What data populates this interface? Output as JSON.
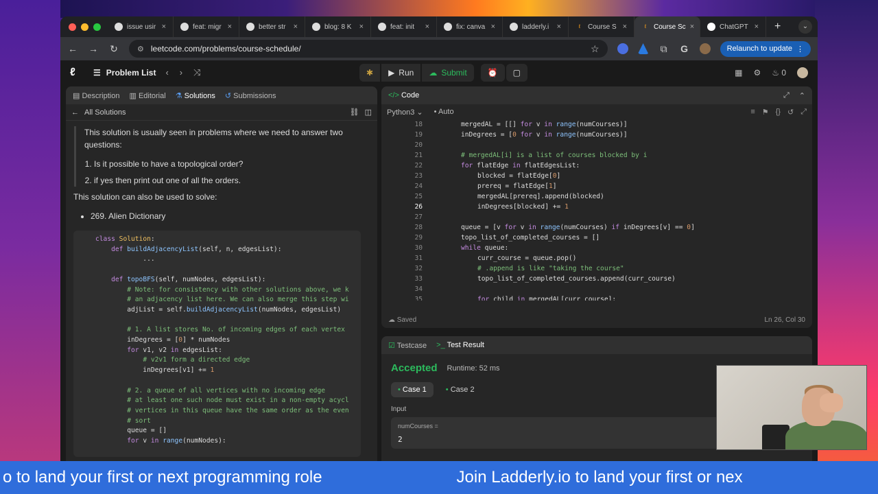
{
  "browser": {
    "tabs": [
      {
        "label": "issue usir",
        "icon": "github-icon"
      },
      {
        "label": "feat: migr",
        "icon": "github-icon"
      },
      {
        "label": "better str",
        "icon": "github-icon"
      },
      {
        "label": "blog: 8 K",
        "icon": "github-icon"
      },
      {
        "label": "feat: init",
        "icon": "github-icon"
      },
      {
        "label": "fix: canva",
        "icon": "github-icon"
      },
      {
        "label": "ladderly.i",
        "icon": "ladderly-icon"
      },
      {
        "label": "Course S",
        "icon": "leetcode-icon"
      },
      {
        "label": "Course Sc",
        "icon": "leetcode-icon",
        "active": true
      },
      {
        "label": "ChatGPT",
        "icon": "chatgpt-icon"
      }
    ],
    "url": "leetcode.com/problems/course-schedule/",
    "relaunch_label": "Relaunch to update"
  },
  "lc_nav": {
    "problem_list_label": "Problem List",
    "run_label": "Run",
    "submit_label": "Submit",
    "coin_count": "0"
  },
  "left_panel": {
    "tabs": [
      "Description",
      "Editorial",
      "Solutions",
      "Submissions"
    ],
    "active_tab": "Solutions",
    "back_label": "All Solutions",
    "quote_intro": "This solution is usually seen in problems where we need to answer two questions:",
    "quote_items": [
      "Is it possible to have a topological order?",
      "if yes then print out one of all the orders."
    ],
    "solve_heading": "This solution can also be used to solve:",
    "solve_items": [
      "269. Alien Dictionary"
    ]
  },
  "code_panel": {
    "title": "Code",
    "language": "Python3",
    "mode": "Auto",
    "status": "Saved",
    "cursor_pos": "Ln 26, Col 30",
    "current_line": 26,
    "lines": [
      {
        "n": 18,
        "indent": 1,
        "text": "mergedAL = [[] for v in range(numCourses)]"
      },
      {
        "n": 19,
        "indent": 1,
        "text": "inDegrees = [0 for v in range(numCourses)]"
      },
      {
        "n": 20,
        "indent": 0,
        "text": ""
      },
      {
        "n": 21,
        "indent": 1,
        "text": "# mergedAL[i] is a list of courses blocked by i"
      },
      {
        "n": 22,
        "indent": 1,
        "text": "for flatEdge in flatEdgesList:"
      },
      {
        "n": 23,
        "indent": 2,
        "text": "blocked = flatEdge[0]"
      },
      {
        "n": 24,
        "indent": 2,
        "text": "prereq = flatEdge[1]"
      },
      {
        "n": 25,
        "indent": 2,
        "text": "mergedAL[prereq].append(blocked)"
      },
      {
        "n": 26,
        "indent": 2,
        "text": "inDegrees[blocked] += 1"
      },
      {
        "n": 27,
        "indent": 0,
        "text": ""
      },
      {
        "n": 28,
        "indent": 1,
        "text": "queue = [v for v in range(numCourses) if inDegrees[v] == 0]"
      },
      {
        "n": 29,
        "indent": 1,
        "text": "topo_list_of_completed_courses = []"
      },
      {
        "n": 30,
        "indent": 1,
        "text": "while queue:"
      },
      {
        "n": 31,
        "indent": 2,
        "text": "curr_course = queue.pop()"
      },
      {
        "n": 32,
        "indent": 2,
        "text": "# .append is like \"taking the course\""
      },
      {
        "n": 33,
        "indent": 2,
        "text": "topo_list_of_completed_courses.append(curr_course)"
      },
      {
        "n": 34,
        "indent": 0,
        "text": ""
      },
      {
        "n": 35,
        "indent": 2,
        "text": "for child in mergedAL[curr_course]:"
      }
    ]
  },
  "solution_code": [
    "class Solution:",
    "    def buildAdjacencyList(self, n, edgesList):",
    "            ...",
    "",
    "    def topoBFS(self, numNodes, edgesList):",
    "        # Note: for consistency with other solutions above, we k",
    "        # an adjacency list here. We can also merge this step wi",
    "        adjList = self.buildAdjacencyList(numNodes, edgesList)",
    "",
    "        # 1. A list stores No. of incoming edges of each vertex",
    "        inDegrees = [0] * numNodes",
    "        for v1, v2 in edgesList:",
    "            # v2v1 form a directed edge",
    "            inDegrees[v1] += 1",
    "",
    "        # 2. a queue of all vertices with no incoming edge",
    "        # at least one such node must exist in a non-empty acycl",
    "        # vertices in this queue have the same order as the even",
    "        # sort",
    "        queue = []",
    "        for v in range(numNodes):"
  ],
  "test_panel": {
    "tabs": [
      "Testcase",
      "Test Result"
    ],
    "active_tab": "Test Result",
    "result": "Accepted",
    "runtime": "Runtime: 52 ms",
    "cases": [
      "Case 1",
      "Case 2"
    ],
    "selected_case": "Case 1",
    "input_label": "Input",
    "input_key": "numCourses =",
    "input_value": "2"
  },
  "ticker": {
    "text_a": "o to land your first or next programming role",
    "text_b": "Join Ladderly.io to land your first or nex"
  },
  "colors": {
    "accepted": "#2cbb5d",
    "ticker_bg": "#2f6ddb",
    "relaunch_bg": "#1a5fb4"
  }
}
